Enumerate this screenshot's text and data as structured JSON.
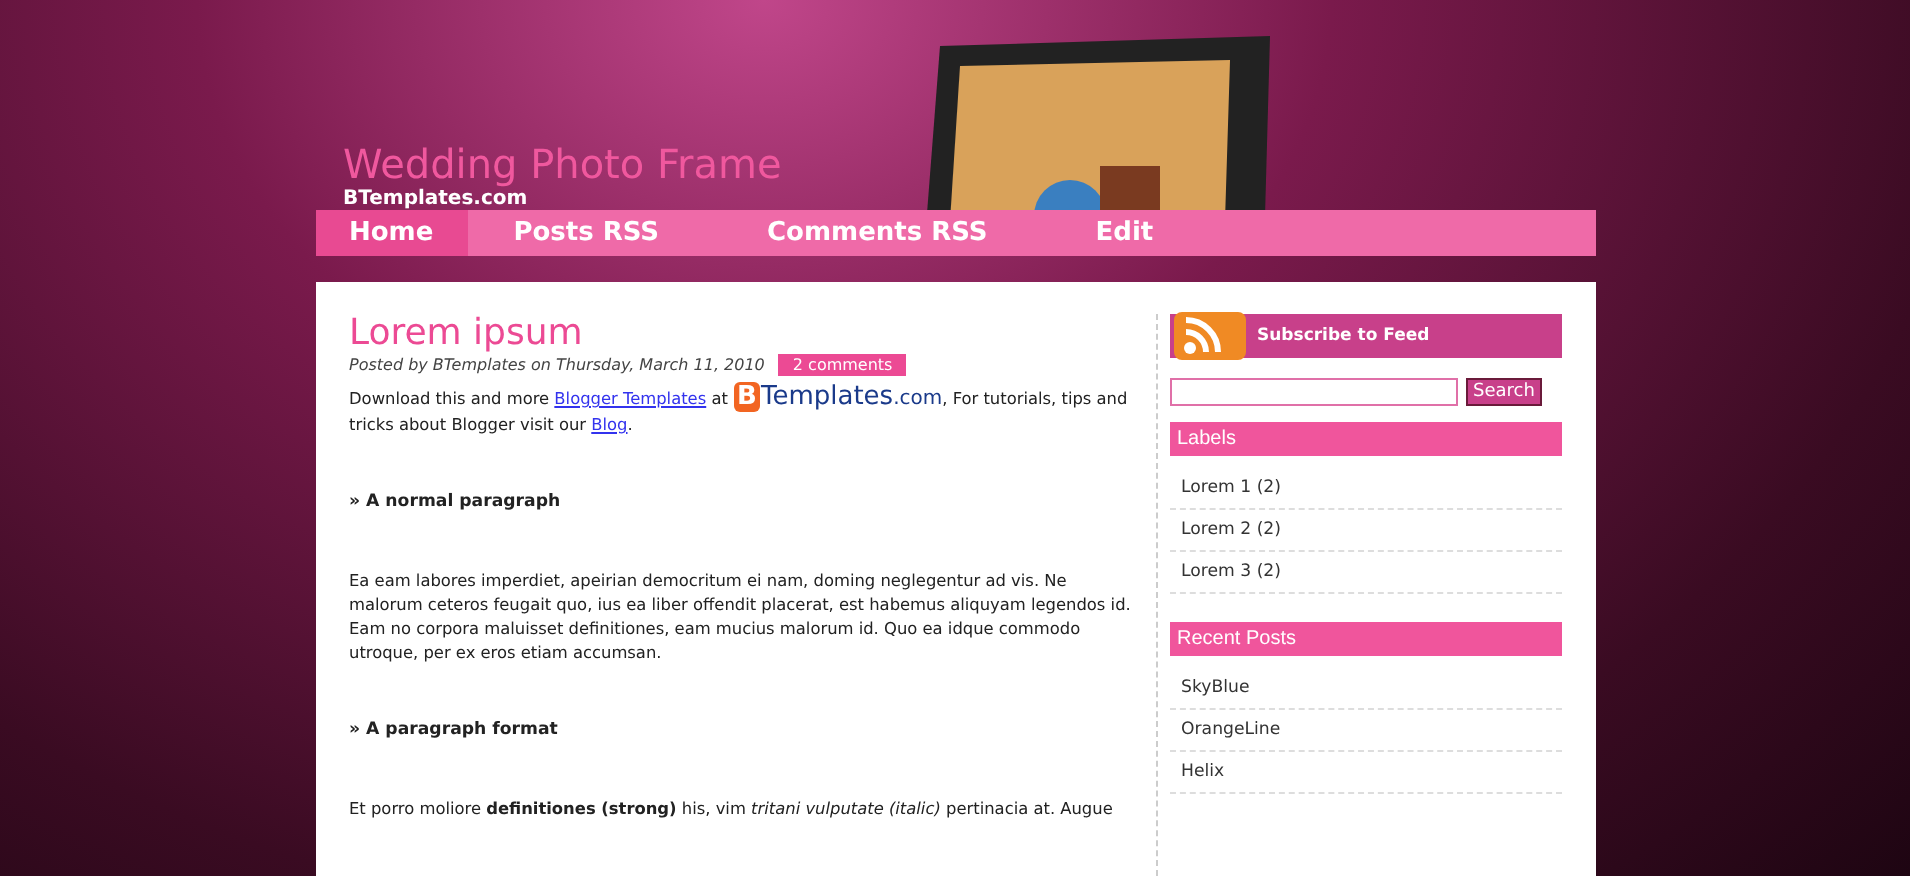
{
  "header": {
    "title": "Wedding Photo Frame",
    "subtitle": "BTemplates.com"
  },
  "nav": [
    {
      "label": "Home",
      "selected": true
    },
    {
      "label": "Posts RSS",
      "selected": false
    },
    {
      "label": "Comments RSS",
      "selected": false
    },
    {
      "label": "Edit",
      "selected": false
    }
  ],
  "post": {
    "title": "Lorem ipsum",
    "meta": "Posted by BTemplates on Thursday, March 11, 2010",
    "comments": "2 comments",
    "intro": {
      "before": "Download this and more ",
      "link1": "Blogger Templates",
      "middle": " at ",
      "logo_letter": "B",
      "logo_text": "Templates",
      "logo_tld": ".com",
      "after": ", For tutorials, tips and tricks about Blogger visit our ",
      "link2": "Blog",
      "end": "."
    },
    "blocks": [
      {
        "kind": "heading",
        "text": "» A normal paragraph"
      },
      {
        "kind": "paragraph",
        "text": "Ea eam labores imperdiet, apeirian democritum ei nam, doming neglegentur ad vis. Ne malorum ceteros feugait quo, ius ea liber offendit placerat, est habemus aliquyam legendos id. Eam no corpora maluisset definitiones, eam mucius malorum id. Quo ea idque commodo utroque, per ex eros etiam accumsan."
      },
      {
        "kind": "heading",
        "text": "» A paragraph format"
      },
      {
        "kind": "paragraph",
        "text": "Et porro moliore **definitiones (strong)** his, vim *tritani vulputate (italic)* pertinacia at. Augue"
      }
    ]
  },
  "sidebar": {
    "subscribe": "Subscribe to Feed",
    "search_button": "Search",
    "widgets": [
      {
        "title": "Labels",
        "items": [
          "Lorem 1 (2)",
          "Lorem 2 (2)",
          "Lorem 3 (2)"
        ]
      },
      {
        "title": "Recent Posts",
        "items": [
          "SkyBlue",
          "OrangeLine",
          "Helix"
        ]
      }
    ]
  }
}
